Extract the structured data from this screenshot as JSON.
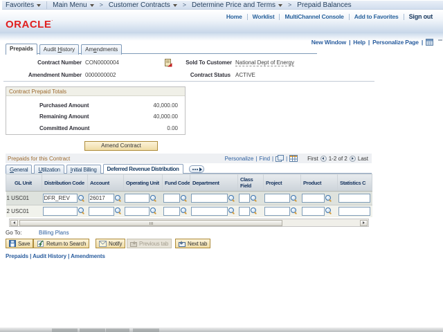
{
  "breadcrumb": {
    "favorites": "Favorites",
    "main_menu": "Main Menu",
    "items": [
      "Customer Contracts",
      "Determine Price and Terms",
      "Prepaid Balances"
    ]
  },
  "header_links": {
    "home": "Home",
    "worklist": "Worklist",
    "multichannel": "MultiChannel Console",
    "add_favorites": "Add to Favorites",
    "sign_out": "Sign out"
  },
  "logo": "ORACLE",
  "utility": {
    "new_window": "New Window",
    "help": "Help",
    "personalize_page": "Personalize Page"
  },
  "tabs": [
    {
      "label": "Prepaids",
      "active": true
    },
    {
      "label": "Audit History",
      "ul": 6
    },
    {
      "label": "Amendments",
      "ul": 2
    }
  ],
  "fields": {
    "contract_number_label": "Contract Number",
    "contract_number": "CON0000004",
    "amendment_number_label": "Amendment Number",
    "amendment_number": "0000000002",
    "sold_to_label": "Sold To Customer",
    "sold_to": "National Dept of Energy",
    "status_label": "Contract Status",
    "status": "ACTIVE"
  },
  "totals": {
    "title": "Contract Prepaid Totals",
    "rows": [
      {
        "label": "Purchased Amount",
        "value": "40,000.00"
      },
      {
        "label": "Remaining Amount",
        "value": "40,000.00"
      },
      {
        "label": "Committed Amount",
        "value": "0.00"
      }
    ],
    "amend_button": "Amend Contract"
  },
  "grid": {
    "title": "Prepaids for this Contract",
    "personalize": "Personalize",
    "find": "Find",
    "pagination": {
      "first": "First",
      "range": "1-2 of 2",
      "last": "Last"
    },
    "subtabs": [
      {
        "label": "General",
        "ul": 0
      },
      {
        "label": "Utilization",
        "ul": 0
      },
      {
        "label": "Initial Billing",
        "ul": 0
      },
      {
        "label": "Deferred Revenue Distribution",
        "active": true
      }
    ],
    "columns": [
      "GL Unit",
      "Distribution Code",
      "Account",
      "Operating Unit",
      "Fund Code",
      "Department",
      "Class Field",
      "Project",
      "Product",
      "Statistics C"
    ],
    "rows": [
      {
        "rowhead": "1 USC01",
        "values": [
          "DFR_REV",
          "26017",
          "",
          "",
          "",
          "",
          "",
          "",
          ""
        ]
      },
      {
        "rowhead": "2 USC01",
        "values": [
          "",
          "",
          "",
          "",
          "",
          "",
          "",
          "",
          ""
        ]
      }
    ]
  },
  "goto": {
    "label": "Go To:",
    "link": "Billing Plans"
  },
  "toolbar": {
    "save": "Save",
    "return_to_search": "Return to Search",
    "notify": "Notify",
    "previous_tab": "Previous tab",
    "next_tab": "Next tab"
  },
  "footer_links": [
    "Prepaids",
    "Audit History",
    "Amendments"
  ]
}
